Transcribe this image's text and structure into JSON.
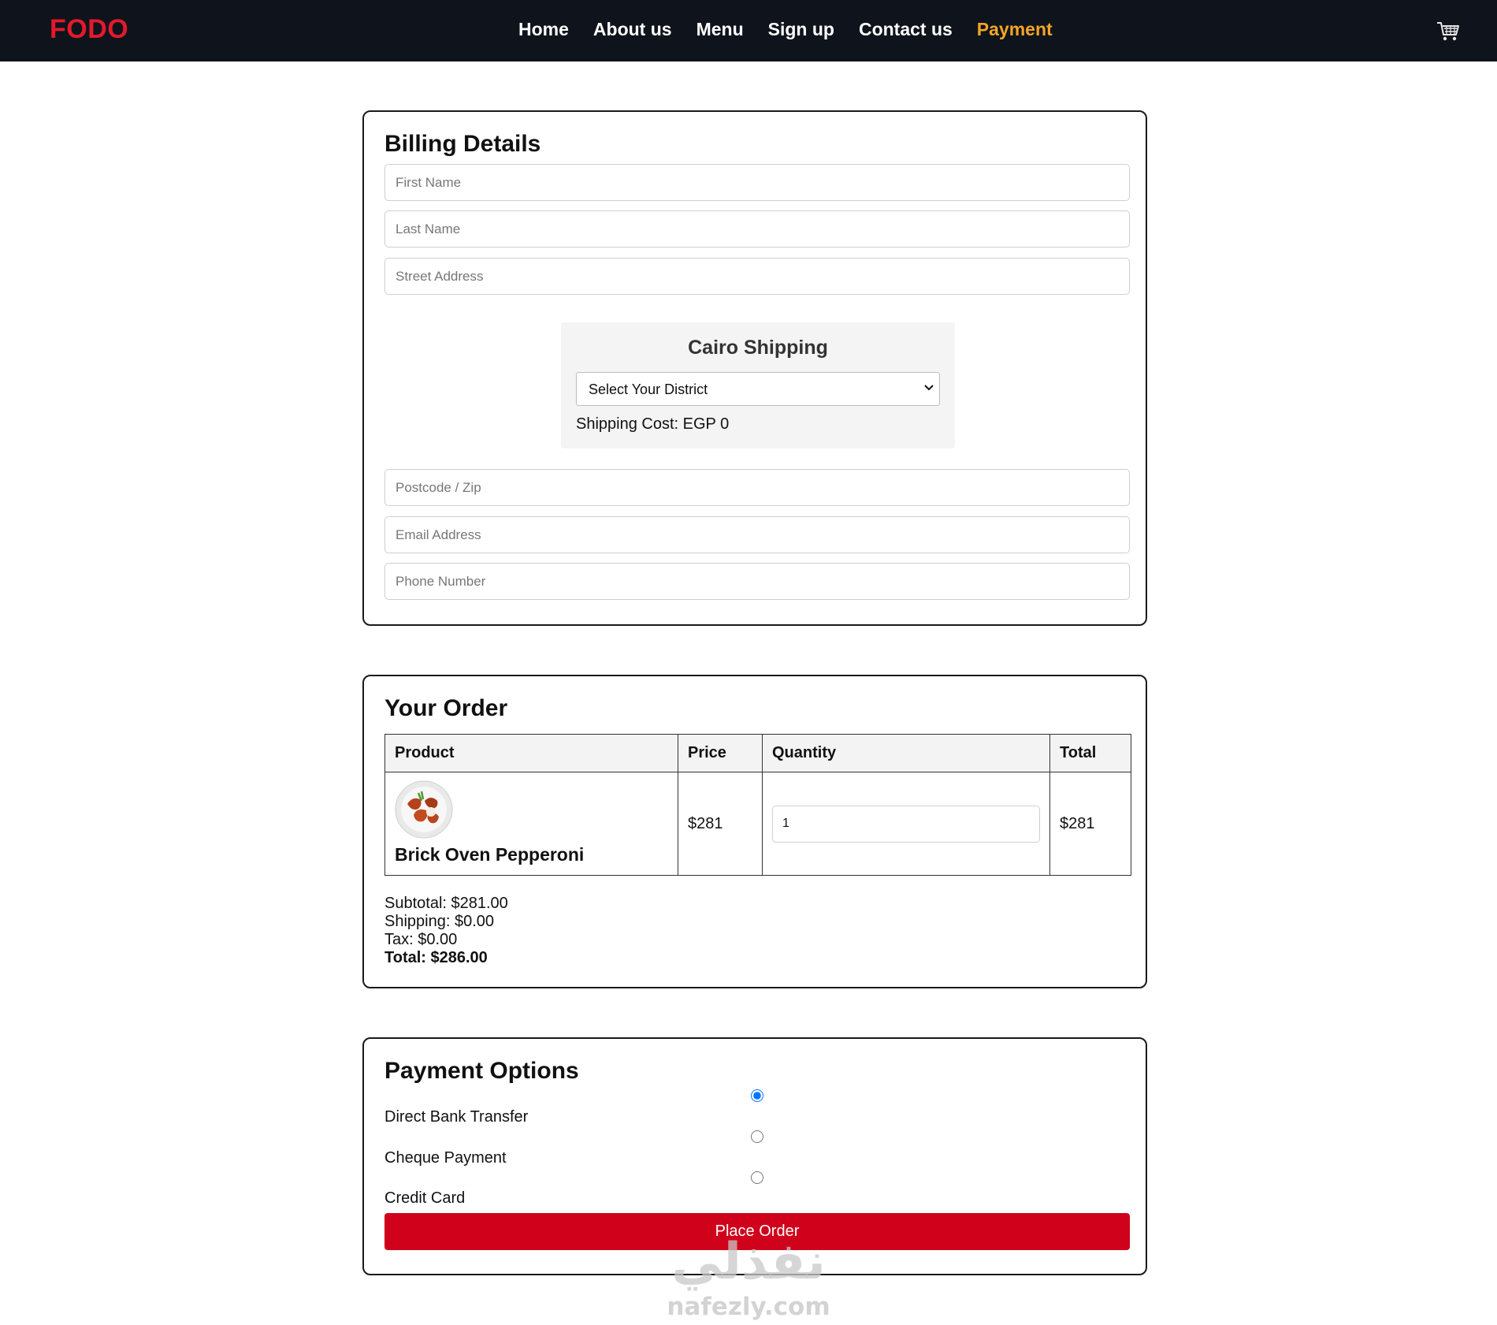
{
  "brand": "FODO",
  "nav": {
    "links": [
      {
        "label": "Home"
      },
      {
        "label": "About us"
      },
      {
        "label": "Menu"
      },
      {
        "label": "Sign up"
      },
      {
        "label": "Contact us"
      },
      {
        "label": "Payment",
        "active": true
      }
    ],
    "cart_icon": "shopping-cart-icon"
  },
  "billing": {
    "title": "Billing Details",
    "fields": {
      "first_name": "First Name",
      "last_name": "Last Name",
      "street": "Street Address",
      "postcode": "Postcode / Zip",
      "email": "Email Address",
      "phone": "Phone Number"
    },
    "shipping": {
      "title": "Cairo Shipping",
      "district_selected": "Select Your District",
      "cost": "Shipping Cost: EGP 0"
    }
  },
  "order": {
    "title": "Your Order",
    "columns": [
      "Product",
      "Price",
      "Quantity",
      "Total"
    ],
    "items": [
      {
        "name": "Brick Oven Pepperoni",
        "price": "$281",
        "quantity": "1",
        "total": "$281"
      }
    ],
    "subtotal": "Subtotal: $281.00",
    "shipping": "Shipping: $0.00",
    "tax": "Tax: $0.00",
    "total": "Total: $286.00"
  },
  "payment": {
    "title": "Payment Options",
    "options": [
      {
        "label": "Direct Bank Transfer",
        "selected": true
      },
      {
        "label": "Cheque Payment",
        "selected": false
      },
      {
        "label": "Credit Card",
        "selected": false
      }
    ],
    "place_order": "Place Order"
  },
  "colors": {
    "nav_bg": "#0f131c",
    "brand_red": "#e3192b",
    "active_link": "#f5a623",
    "button_red": "#d0021b"
  },
  "watermark": {
    "arabic": "نفذلي",
    "latin": "nafezly.com"
  }
}
